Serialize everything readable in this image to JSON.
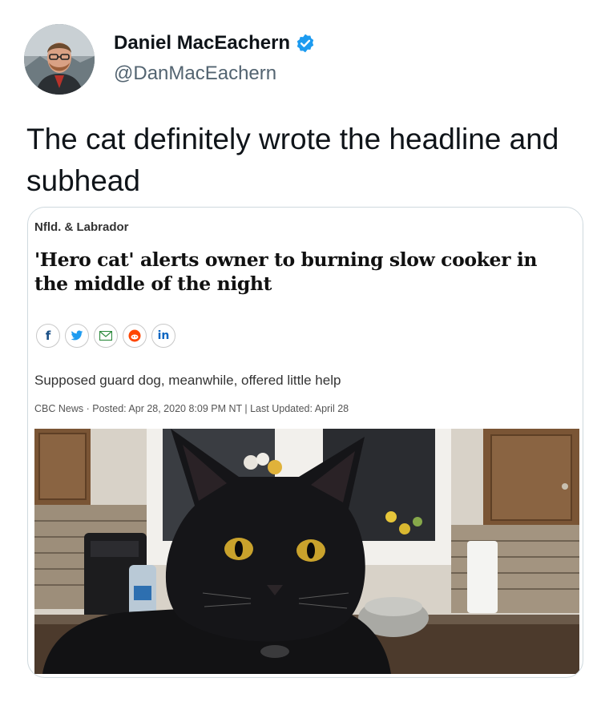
{
  "tweet": {
    "display_name": "Daniel MacEachern",
    "handle": "@DanMacEachern",
    "text": "The cat definitely wrote the headline and subhead"
  },
  "article_card": {
    "section": "Nfld. & Labrador",
    "headline": "'Hero cat' alerts owner to burning slow cooker in the middle of the night",
    "share_buttons": [
      {
        "icon": "facebook-icon",
        "glyph": "f"
      },
      {
        "icon": "twitter-icon",
        "glyph": "🐦"
      },
      {
        "icon": "email-icon",
        "glyph": "✉"
      },
      {
        "icon": "reddit-icon",
        "glyph": "●"
      },
      {
        "icon": "linkedin-icon",
        "glyph": "in"
      }
    ],
    "subhead": "Supposed guard dog, meanwhile, offered little help",
    "byline": "CBC News · Posted: Apr 28, 2020 8:09 PM NT | Last Updated: April 28"
  },
  "colors": {
    "verified_badge": "#1d9bf0",
    "handle_gray": "#536471",
    "card_border": "#cfd9de"
  }
}
